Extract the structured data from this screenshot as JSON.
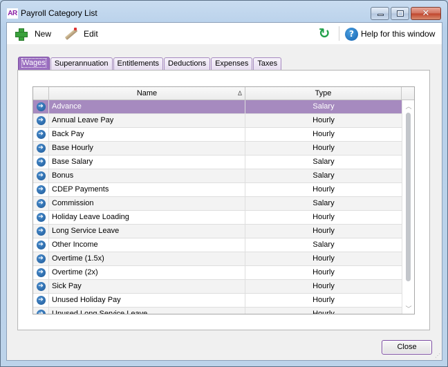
{
  "window": {
    "app_logo": "AR",
    "title": "Payroll Category List",
    "controls": {
      "minimize": "minimize",
      "maximize": "maximize",
      "close": "✕"
    }
  },
  "toolbar": {
    "new_label": "New",
    "edit_label": "Edit",
    "refresh_icon": "↻",
    "help_label": "Help for this window",
    "help_icon": "?"
  },
  "tabs": [
    {
      "label": "Wages",
      "active": true
    },
    {
      "label": "Superannuation",
      "active": false
    },
    {
      "label": "Entitlements",
      "active": false
    },
    {
      "label": "Deductions",
      "active": false
    },
    {
      "label": "Expenses",
      "active": false
    },
    {
      "label": "Taxes",
      "active": false
    }
  ],
  "grid": {
    "columns": {
      "name": "Name",
      "type": "Type"
    },
    "sort_indicator": "Δ",
    "row_icon": "➔",
    "rows": [
      {
        "name": "Advance",
        "type": "Salary",
        "selected": true
      },
      {
        "name": "Annual Leave Pay",
        "type": "Hourly"
      },
      {
        "name": "Back Pay",
        "type": "Hourly"
      },
      {
        "name": "Base Hourly",
        "type": "Hourly"
      },
      {
        "name": "Base Salary",
        "type": "Salary"
      },
      {
        "name": "Bonus",
        "type": "Salary"
      },
      {
        "name": "CDEP Payments",
        "type": "Hourly"
      },
      {
        "name": "Commission",
        "type": "Salary"
      },
      {
        "name": "Holiday Leave Loading",
        "type": "Hourly"
      },
      {
        "name": "Long Service Leave",
        "type": "Hourly"
      },
      {
        "name": "Other Income",
        "type": "Salary"
      },
      {
        "name": "Overtime (1.5x)",
        "type": "Hourly"
      },
      {
        "name": "Overtime (2x)",
        "type": "Hourly"
      },
      {
        "name": "Sick Pay",
        "type": "Hourly"
      },
      {
        "name": "Unused Holiday Pay",
        "type": "Hourly"
      },
      {
        "name": "Unused Long Service Leave",
        "type": "Hourly"
      }
    ],
    "scroll_up": "︿",
    "scroll_down": "﹀"
  },
  "footer": {
    "close_label": "Close"
  }
}
